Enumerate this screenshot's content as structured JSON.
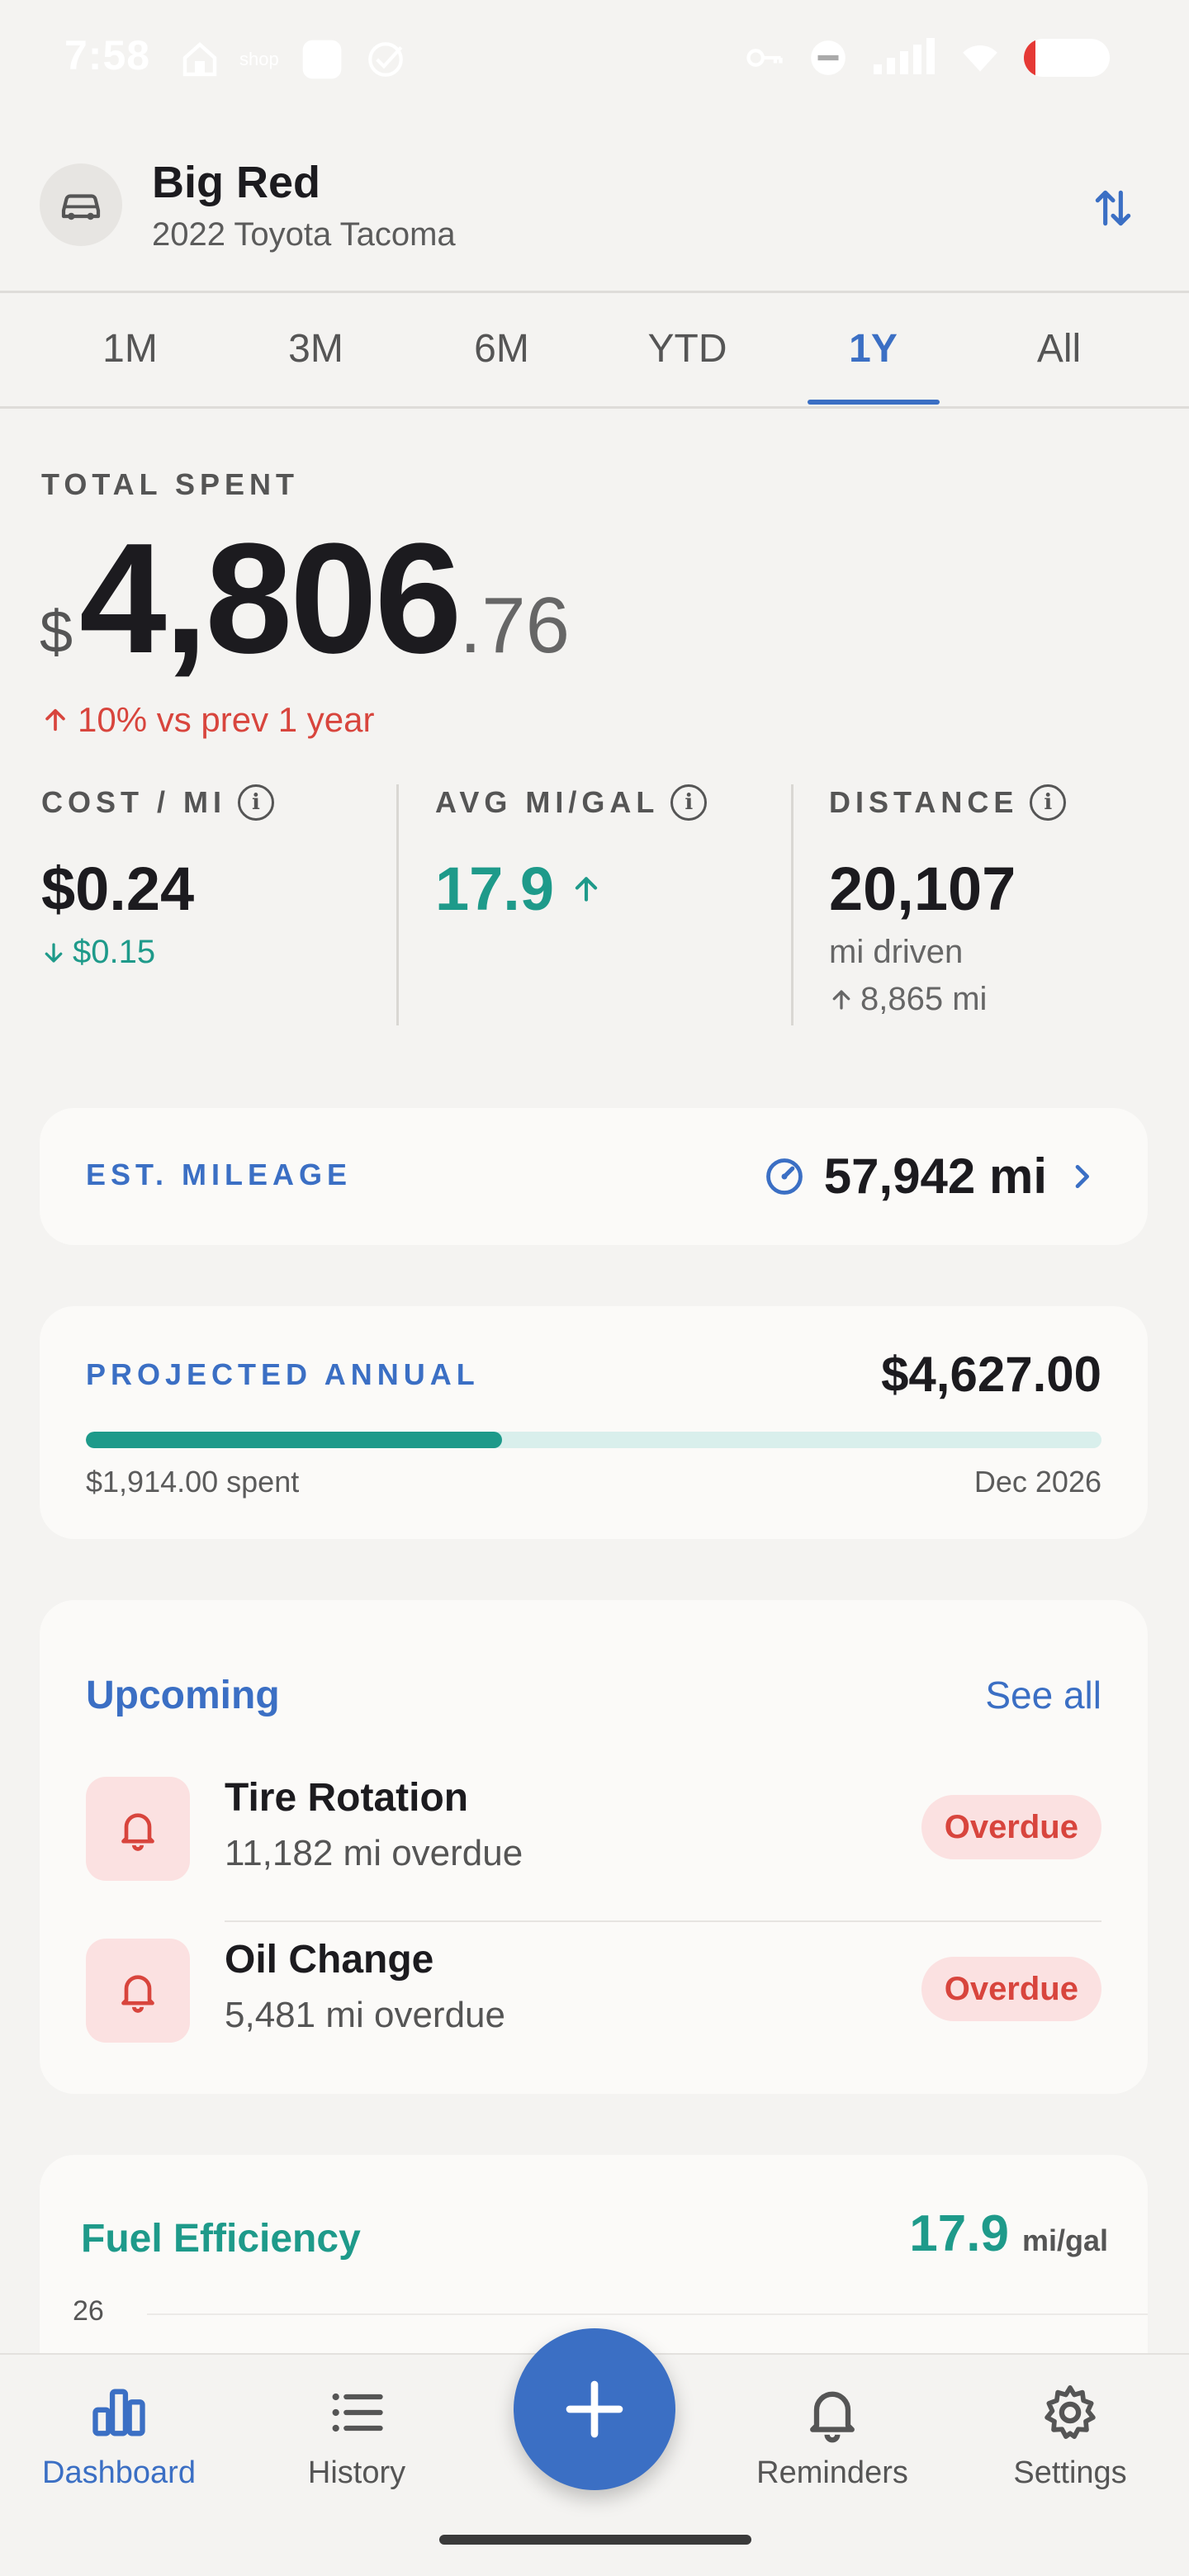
{
  "status_bar": {
    "time": "7:58",
    "shop_label": "shop"
  },
  "vehicle": {
    "name": "Big Red",
    "model": "2022 Toyota Tacoma"
  },
  "tabs": [
    {
      "label": "1M",
      "active": false
    },
    {
      "label": "3M",
      "active": false
    },
    {
      "label": "6M",
      "active": false
    },
    {
      "label": "YTD",
      "active": false
    },
    {
      "label": "1Y",
      "active": true
    },
    {
      "label": "All",
      "active": false
    }
  ],
  "total_spent": {
    "label": "TOTAL SPENT",
    "currency": "$",
    "whole": "4,806",
    "cents": ".76",
    "trend": "10% vs prev 1 year"
  },
  "stats": {
    "cost_per_mi": {
      "label": "COST / MI",
      "value": "$0.24",
      "sub": "$0.15"
    },
    "avg_mpg": {
      "label": "AVG MI/GAL",
      "value": "17.9"
    },
    "distance": {
      "label": "DISTANCE",
      "value": "20,107",
      "unit": "mi driven",
      "sub": "8,865 mi"
    }
  },
  "est_mileage": {
    "label": "EST. MILEAGE",
    "value": "57,942 mi"
  },
  "projected": {
    "label": "PROJECTED ANNUAL",
    "value": "$4,627.00",
    "spent": "$1,914.00 spent",
    "date": "Dec 2026",
    "progress": 0.41
  },
  "upcoming": {
    "title": "Upcoming",
    "see_all": "See all",
    "items": [
      {
        "title": "Tire Rotation",
        "sub": "11,182 mi overdue",
        "badge": "Overdue"
      },
      {
        "title": "Oil Change",
        "sub": "5,481 mi overdue",
        "badge": "Overdue"
      }
    ]
  },
  "fuel": {
    "title": "Fuel Efficiency",
    "value": "17.9",
    "unit": "mi/gal",
    "y_tick": "26"
  },
  "nav": {
    "dashboard": "Dashboard",
    "history": "History",
    "reminders": "Reminders",
    "settings": "Settings"
  },
  "colors": {
    "accent": "#3b6fc4",
    "teal": "#1e9a8a",
    "danger": "#d8453d",
    "background": "#f4f3f1"
  }
}
